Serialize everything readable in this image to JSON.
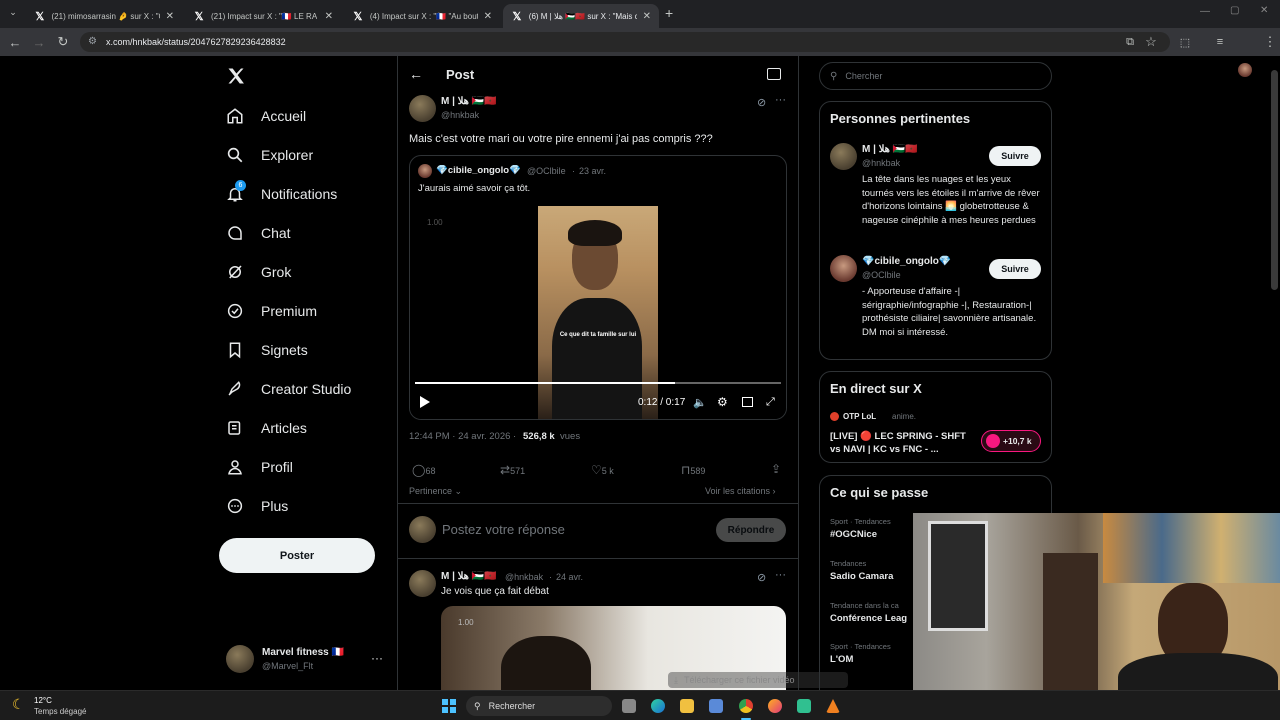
{
  "browser": {
    "tabs": [
      {
        "title": "(21) mimosarrasin 🤌 sur X : \"C"
      },
      {
        "title": "(21) Impact sur X : \"🇫🇷 LE RA"
      },
      {
        "title": "(4) Impact sur X : \"🇫🇷 \"Au bout"
      },
      {
        "title": "(6) M | ﻫﻠﺎ 🇵🇸🇲🇦 sur X : \"Mais c"
      }
    ],
    "url": "x.com/hnkbak/status/2047627829236428832"
  },
  "nav": {
    "items": [
      {
        "label": "Accueil",
        "icon": "home-icon"
      },
      {
        "label": "Explorer",
        "icon": "search-icon"
      },
      {
        "label": "Notifications",
        "icon": "bell-icon",
        "badge": "6"
      },
      {
        "label": "Chat",
        "icon": "chat-icon"
      },
      {
        "label": "Grok",
        "icon": "grok-icon"
      },
      {
        "label": "Premium",
        "icon": "premium-icon"
      },
      {
        "label": "Signets",
        "icon": "bookmark-icon"
      },
      {
        "label": "Creator Studio",
        "icon": "rocket-icon"
      },
      {
        "label": "Articles",
        "icon": "article-icon"
      },
      {
        "label": "Profil",
        "icon": "person-icon"
      },
      {
        "label": "Plus",
        "icon": "more-icon"
      }
    ],
    "post_label": "Poster",
    "account": {
      "name": "Marvel fitness 🇫🇷",
      "handle": "@Marvel_Flt"
    }
  },
  "header": {
    "title": "Post"
  },
  "post": {
    "author": "M | ﻫﻠﺎ 🇵🇸🇲🇦",
    "handle": "@hnkbak",
    "text": "Mais c'est votre mari ou votre pire ennemi j'ai pas compris ???",
    "quote": {
      "author": "💎cibile_ongolo💎",
      "handle": "@OClbile",
      "date": "23 avr.",
      "text": "J'aurais aimé savoir ça tôt.",
      "caption": "Ce que dit ta famille sur lui",
      "speed": "1.00",
      "time": "0:12 / 0:17"
    },
    "timestamp": "12:44 PM · 24 avr. 2026 ·",
    "views_count": "526,8 k",
    "views_label": "vues",
    "stats": {
      "replies": "68",
      "reposts": "571",
      "likes": "5 k",
      "bookmarks": "589"
    },
    "relevance": "Pertinence",
    "see_quotes": "Voir les citations",
    "reply_placeholder": "Postez votre réponse",
    "reply_button": "Répondre"
  },
  "reply": {
    "author": "M | ﻫﻠﺎ 🇵🇸🇲🇦",
    "handle": "@hnkbak",
    "date": "24 avr.",
    "text": "Je vois que ça fait débat",
    "speed": "1.00"
  },
  "right": {
    "search_placeholder": "Chercher",
    "relevant_title": "Personnes pertinentes",
    "people": [
      {
        "name": "M | ﻫﻠﺎ 🇵🇸🇲🇦",
        "handle": "@hnkbak",
        "follow": "Suivre",
        "bio": "La tête dans les nuages et les yeux tournés vers les étoiles il m'arrive de rêver d'horizons lointains 🌅 globetrotteuse & nageuse cinéphile à mes heures perdues"
      },
      {
        "name": "💎cibile_ongolo💎",
        "handle": "@OClbile",
        "follow": "Suivre",
        "bio": "- Apporteuse d'affaire -| sérigraphie/infographie -|, Restauration-| prothésiste ciliaire| savonnière artisanale. DM moi si intéressé."
      }
    ],
    "live_title": "En direct sur X",
    "live": {
      "host": "OTP LoL",
      "role": "anime.",
      "title": "[LIVE] 🔴 LEC SPRING - SHFT vs NAVI | KC vs FNC - ...",
      "count": "+10,7 k"
    },
    "trends_title": "Ce qui se passe",
    "trends": [
      {
        "context": "Sport · Tendances",
        "name": "#OGCNice"
      },
      {
        "context": "Tendances",
        "name": "Sadio Camara"
      },
      {
        "context": "Tendance dans la ca",
        "name": "Conférence Leag"
      },
      {
        "context": "Sport · Tendances",
        "name": "L'OM"
      }
    ]
  },
  "download_overlay": "Télécharger ce fichier vidéo",
  "taskbar": {
    "weather_temp": "12°C",
    "weather_desc": "Temps dégagé",
    "search": "Rechercher"
  },
  "colors": {
    "accent": "#1d9bf0",
    "background": "#000000",
    "live_red": "#f91880"
  }
}
